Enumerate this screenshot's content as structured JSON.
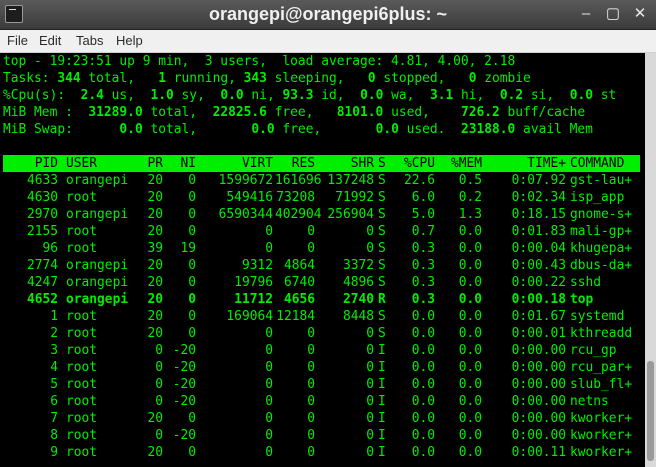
{
  "window": {
    "title": "orangepi@orangepi6plus: ~",
    "icon": "terminal-icon",
    "controls": {
      "minimize": "–",
      "maximize": "▢",
      "close": "✕"
    }
  },
  "menu": {
    "file": "File",
    "edit": "Edit",
    "tabs": "Tabs",
    "help": "Help"
  },
  "summary": {
    "line1": "top - 19:23:51 up 9 min,  3 users,  load average: 4.81, 4.00, 2.18",
    "tasks": {
      "label": "Tasks: ",
      "total": "344",
      "total_l": " total,   ",
      "running": "1",
      "running_l": " running, ",
      "sleeping": "343",
      "sleeping_l": " sleeping,   ",
      "stopped": "0",
      "stopped_l": " stopped,   ",
      "zombie": "0",
      "zombie_l": " zombie"
    },
    "cpu": {
      "label": "%Cpu(s):  ",
      "us": "2.4",
      "us_l": " us,  ",
      "sy": "1.0",
      "sy_l": " sy,  ",
      "ni": "0.0",
      "ni_l": " ni, ",
      "id": "93.3",
      "id_l": " id,  ",
      "wa": "0.0",
      "wa_l": " wa,  ",
      "hi": "3.1",
      "hi_l": " hi,  ",
      "si": "0.2",
      "si_l": " si,  ",
      "st": "0.0",
      "st_l": " st"
    },
    "mem": {
      "label": "MiB Mem :  ",
      "total": "31289.0",
      "total_l": " total,  ",
      "free": "22825.6",
      "free_l": " free,   ",
      "used": "8101.0",
      "used_l": " used,    ",
      "buff": "726.2",
      "buff_l": " buff/cache"
    },
    "swap": {
      "label": "MiB Swap:      ",
      "total": "0.0",
      "total_l": " total,       ",
      "free": "0.0",
      "free_l": " free,       ",
      "used": "0.0",
      "used_l": " used.  ",
      "avail": "23188.0",
      "avail_l": " avail Mem"
    }
  },
  "table": {
    "columns": {
      "pid": "PID",
      "user": "USER",
      "pr": "PR",
      "ni": "NI",
      "virt": "VIRT",
      "res": "RES",
      "shr": "SHR",
      "s": "S",
      "cpu": "%CPU",
      "mem": "%MEM",
      "time": "TIME+",
      "cmd": "COMMAND"
    },
    "rows": [
      {
        "pid": "4633",
        "user": "orangepi",
        "pr": "20",
        "ni": "0",
        "virt": "1599672",
        "res": "161696",
        "shr": "137248",
        "s": "S",
        "cpu": "22.6",
        "mem": "0.5",
        "time": "0:07.92",
        "cmd": "gst-lau+",
        "bold": false
      },
      {
        "pid": "4630",
        "user": "root",
        "pr": "20",
        "ni": "0",
        "virt": "549416",
        "res": "73208",
        "shr": "71992",
        "s": "S",
        "cpu": "6.0",
        "mem": "0.2",
        "time": "0:02.34",
        "cmd": "isp_app",
        "bold": false
      },
      {
        "pid": "2970",
        "user": "orangepi",
        "pr": "20",
        "ni": "0",
        "virt": "6590344",
        "res": "402904",
        "shr": "256904",
        "s": "S",
        "cpu": "5.0",
        "mem": "1.3",
        "time": "0:18.15",
        "cmd": "gnome-s+",
        "bold": false
      },
      {
        "pid": "2155",
        "user": "root",
        "pr": "20",
        "ni": "0",
        "virt": "0",
        "res": "0",
        "shr": "0",
        "s": "S",
        "cpu": "0.7",
        "mem": "0.0",
        "time": "0:01.83",
        "cmd": "mali-gp+",
        "bold": false
      },
      {
        "pid": "96",
        "user": "root",
        "pr": "39",
        "ni": "19",
        "virt": "0",
        "res": "0",
        "shr": "0",
        "s": "S",
        "cpu": "0.3",
        "mem": "0.0",
        "time": "0:00.04",
        "cmd": "khugepa+",
        "bold": false
      },
      {
        "pid": "2774",
        "user": "orangepi",
        "pr": "20",
        "ni": "0",
        "virt": "9312",
        "res": "4864",
        "shr": "3372",
        "s": "S",
        "cpu": "0.3",
        "mem": "0.0",
        "time": "0:00.43",
        "cmd": "dbus-da+",
        "bold": false
      },
      {
        "pid": "4247",
        "user": "orangepi",
        "pr": "20",
        "ni": "0",
        "virt": "19796",
        "res": "6740",
        "shr": "4896",
        "s": "S",
        "cpu": "0.3",
        "mem": "0.0",
        "time": "0:00.22",
        "cmd": "sshd",
        "bold": false
      },
      {
        "pid": "4652",
        "user": "orangepi",
        "pr": "20",
        "ni": "0",
        "virt": "11712",
        "res": "4656",
        "shr": "2740",
        "s": "R",
        "cpu": "0.3",
        "mem": "0.0",
        "time": "0:00.18",
        "cmd": "top",
        "bold": true
      },
      {
        "pid": "1",
        "user": "root",
        "pr": "20",
        "ni": "0",
        "virt": "169064",
        "res": "12184",
        "shr": "8448",
        "s": "S",
        "cpu": "0.0",
        "mem": "0.0",
        "time": "0:01.67",
        "cmd": "systemd",
        "bold": false
      },
      {
        "pid": "2",
        "user": "root",
        "pr": "20",
        "ni": "0",
        "virt": "0",
        "res": "0",
        "shr": "0",
        "s": "S",
        "cpu": "0.0",
        "mem": "0.0",
        "time": "0:00.01",
        "cmd": "kthreadd",
        "bold": false
      },
      {
        "pid": "3",
        "user": "root",
        "pr": "0",
        "ni": "-20",
        "virt": "0",
        "res": "0",
        "shr": "0",
        "s": "I",
        "cpu": "0.0",
        "mem": "0.0",
        "time": "0:00.00",
        "cmd": "rcu_gp",
        "bold": false
      },
      {
        "pid": "4",
        "user": "root",
        "pr": "0",
        "ni": "-20",
        "virt": "0",
        "res": "0",
        "shr": "0",
        "s": "I",
        "cpu": "0.0",
        "mem": "0.0",
        "time": "0:00.00",
        "cmd": "rcu_par+",
        "bold": false
      },
      {
        "pid": "5",
        "user": "root",
        "pr": "0",
        "ni": "-20",
        "virt": "0",
        "res": "0",
        "shr": "0",
        "s": "I",
        "cpu": "0.0",
        "mem": "0.0",
        "time": "0:00.00",
        "cmd": "slub_fl+",
        "bold": false
      },
      {
        "pid": "6",
        "user": "root",
        "pr": "0",
        "ni": "-20",
        "virt": "0",
        "res": "0",
        "shr": "0",
        "s": "I",
        "cpu": "0.0",
        "mem": "0.0",
        "time": "0:00.00",
        "cmd": "netns",
        "bold": false
      },
      {
        "pid": "7",
        "user": "root",
        "pr": "20",
        "ni": "0",
        "virt": "0",
        "res": "0",
        "shr": "0",
        "s": "I",
        "cpu": "0.0",
        "mem": "0.0",
        "time": "0:00.00",
        "cmd": "kworker+",
        "bold": false
      },
      {
        "pid": "8",
        "user": "root",
        "pr": "0",
        "ni": "-20",
        "virt": "0",
        "res": "0",
        "shr": "0",
        "s": "I",
        "cpu": "0.0",
        "mem": "0.0",
        "time": "0:00.00",
        "cmd": "kworker+",
        "bold": false
      },
      {
        "pid": "9",
        "user": "root",
        "pr": "20",
        "ni": "0",
        "virt": "0",
        "res": "0",
        "shr": "0",
        "s": "I",
        "cpu": "0.0",
        "mem": "0.0",
        "time": "0:00.11",
        "cmd": "kworker+",
        "bold": false
      }
    ]
  },
  "colors": {
    "terminal_bg": "#000000",
    "terminal_fg": "#00ee00",
    "header_bg": "#00ee00",
    "header_fg": "#000000"
  }
}
